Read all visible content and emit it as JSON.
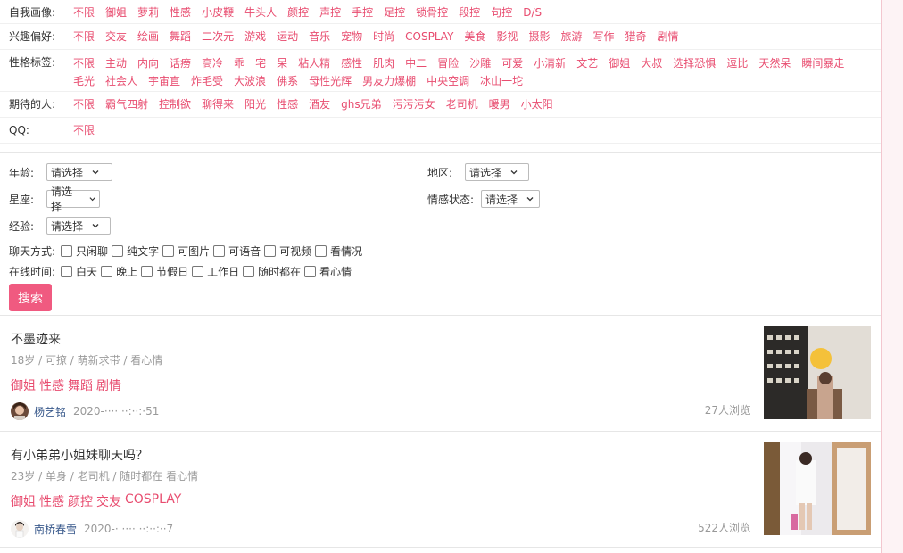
{
  "filters": {
    "self_image": {
      "label": "自我画像:",
      "tags": [
        "不限",
        "御姐",
        "萝莉",
        "性感",
        "小皮鞭",
        "牛头人",
        "颜控",
        "声控",
        "手控",
        "足控",
        "锁骨控",
        "段控",
        "句控",
        "D/S"
      ]
    },
    "interests": {
      "label": "兴趣偏好:",
      "tags": [
        "不限",
        "交友",
        "绘画",
        "舞蹈",
        "二次元",
        "游戏",
        "运动",
        "音乐",
        "宠物",
        "时尚",
        "COSPLAY",
        "美食",
        "影视",
        "摄影",
        "旅游",
        "写作",
        "猎奇",
        "剧情"
      ]
    },
    "character": {
      "label": "性格标签:",
      "tags": [
        "不限",
        "主动",
        "内向",
        "话痨",
        "高冷",
        "乖",
        "宅",
        "呆",
        "粘人精",
        "感性",
        "肌肉",
        "中二",
        "冒险",
        "沙雕",
        "可爱",
        "小清新",
        "文艺",
        "御姐",
        "大叔",
        "选择恐惧",
        "逗比",
        "天然呆",
        "瞬间暴走",
        "毛光",
        "社会人",
        "宇宙直",
        "炸毛受",
        "大波浪",
        "佛系",
        "母性光辉",
        "男友力爆棚",
        "中央空调",
        "冰山一坨"
      ]
    },
    "expected": {
      "label": "期待的人:",
      "tags": [
        "不限",
        "霸气四射",
        "控制欲",
        "聊得来",
        "阳光",
        "性感",
        "酒友",
        "ghs兄弟",
        "污污污女",
        "老司机",
        "暖男",
        "小太阳"
      ]
    },
    "qq": {
      "label": "QQ:",
      "tags": [
        "不限"
      ]
    }
  },
  "search": {
    "age": {
      "label": "年龄:",
      "value": "请选择"
    },
    "region": {
      "label": "地区:",
      "value": "请选择"
    },
    "zodiac": {
      "label": "星座:",
      "value": "请选择"
    },
    "relationship": {
      "label": "情感状态:",
      "value": "请选择"
    },
    "experience": {
      "label": "经验:",
      "value": "请选择"
    },
    "chat_mode": {
      "label": "聊天方式:",
      "options": [
        "只闲聊",
        "纯文字",
        "可图片",
        "可语音",
        "可视频",
        "看情况"
      ]
    },
    "online_time": {
      "label": "在线时间:",
      "options": [
        "白天",
        "晚上",
        "节假日",
        "工作日",
        "随时都在",
        "看心情"
      ]
    },
    "button_label": "搜索"
  },
  "posts": [
    {
      "title": "不墨迹来",
      "meta": "18岁 / 可撩 / 萌新求带 / 看心情",
      "tags": [
        "御姐",
        "性感",
        "舞蹈",
        "剧情"
      ],
      "author": "杨艺铭",
      "date": "2020-···· ··:··:·51",
      "views": "27人浏览"
    },
    {
      "title": "有小弟弟小姐妹聊天吗？",
      "meta": "23岁 / 单身 / 老司机 / 随时都在 看心情",
      "tags": [
        "御姐",
        "性感",
        "颜控",
        "交友",
        "COSPLAY"
      ],
      "author": "南桥春雪",
      "date": "2020-· ···· ··:··:··7",
      "views": "522人浏览"
    }
  ],
  "colors": {
    "accent": "#e84c6f",
    "button": "#f05a80",
    "author": "#3a5a8c",
    "muted": "#999999"
  }
}
